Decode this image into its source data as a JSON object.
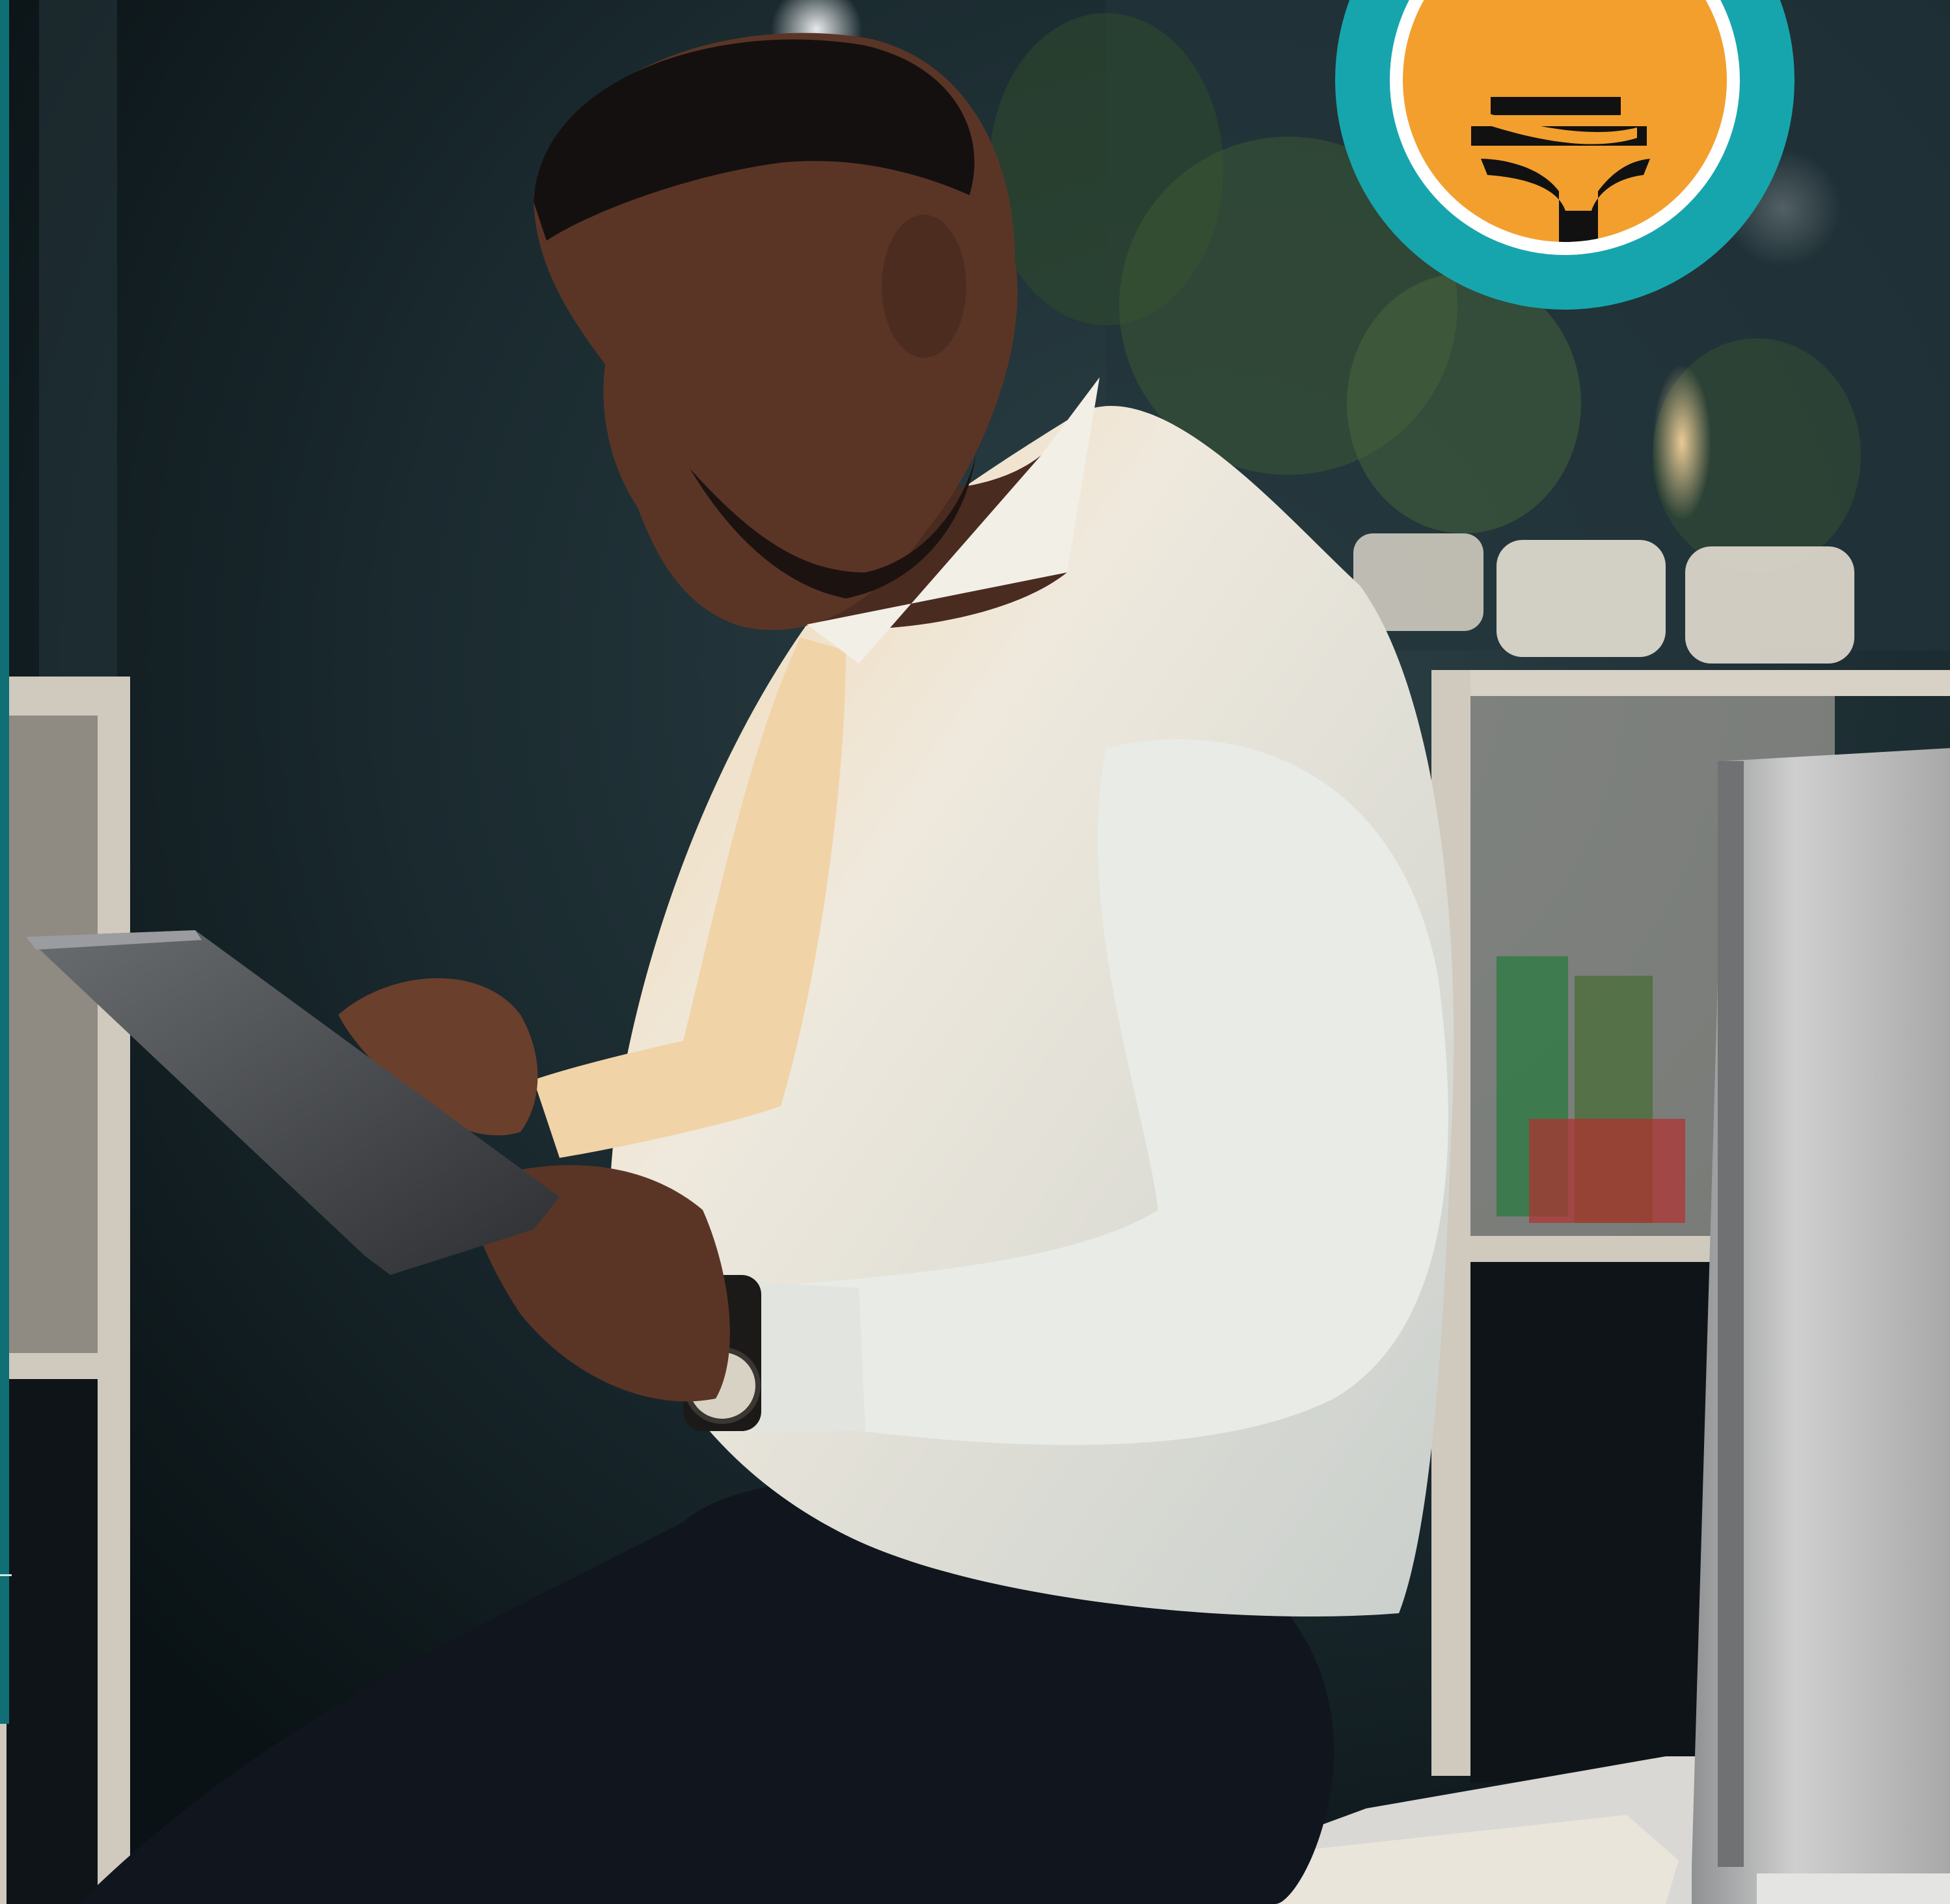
{
  "photo": {
    "subject": "",
    "palette": {
      "background_dark": "#0c1418",
      "wall_teal": "#1d3338",
      "shirt": "#e9e2d4",
      "trousers": "#11161f",
      "skin": "#5a3526",
      "shelf_white": "#d8d2c8",
      "monitor_silver": "#bdbdbd"
    }
  },
  "brand": {
    "badge_outer_color": "#17a5ad",
    "badge_ring_color": "#ffffff",
    "badge_inner_color": "#f39f2e",
    "mark_color": "#111111",
    "edge_stripe_color": "#0f6f74"
  }
}
